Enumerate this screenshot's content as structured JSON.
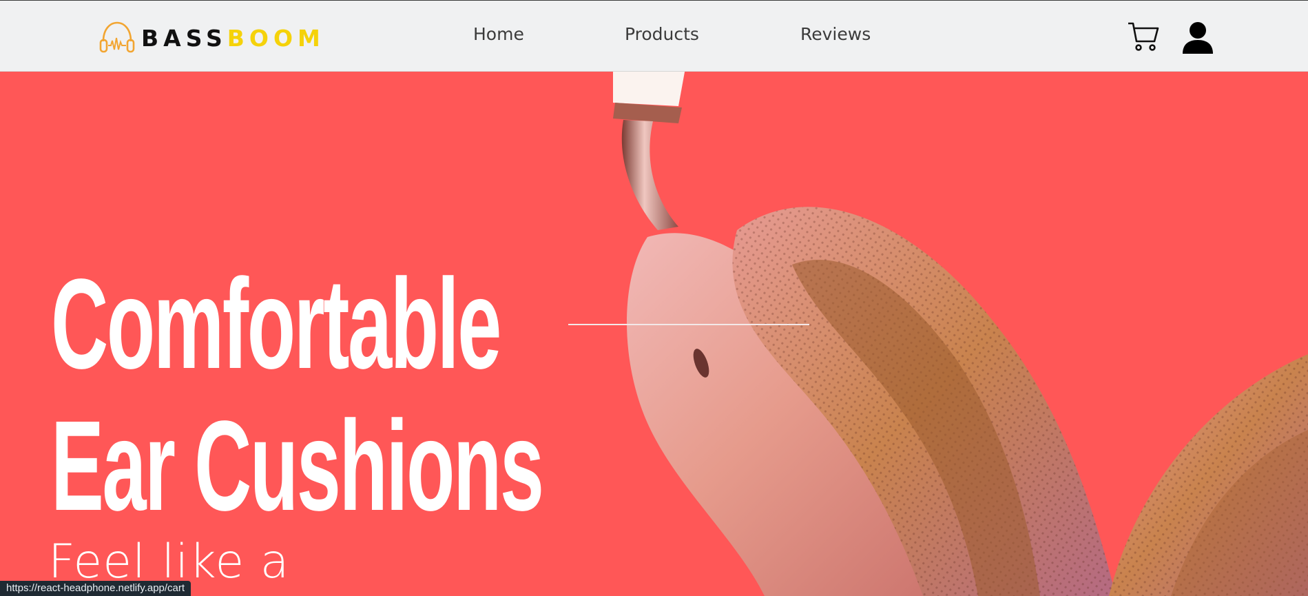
{
  "brand": {
    "logo_part1": "BASS",
    "logo_part2": "BOOM",
    "accent_color": "#f5d20a",
    "icon": "headphone-logo-icon"
  },
  "nav": {
    "links": [
      {
        "label": "Home"
      },
      {
        "label": "Products"
      },
      {
        "label": "Reviews"
      }
    ],
    "cart_icon": "cart-icon",
    "user_icon": "user-icon"
  },
  "hero": {
    "background_color": "#ff5757",
    "headline_line1": "Comfortable",
    "headline_line2": "Ear Cushions",
    "subheadline": "Feel like a",
    "image": "pink-headphone-ear-cushion-image"
  },
  "status_bar": {
    "url": "https://react-headphone.netlify.app/cart"
  }
}
